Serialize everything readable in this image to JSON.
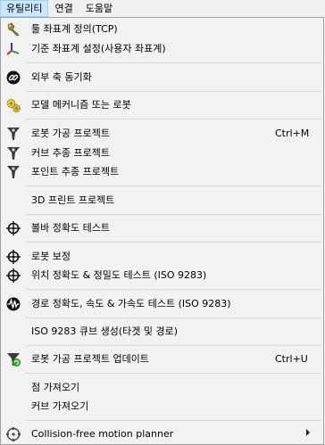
{
  "menubar": {
    "utility": "유틸리티",
    "connect": "연결",
    "help": "도움말"
  },
  "menu": {
    "tool_frame": "툴 좌표계 정의(TCP)",
    "reference_frame": "기준 좌표계 설정(사용자 좌표계)",
    "sync_external_axes": "외부 축 동기화",
    "model_mechanism_robot": "모델 메커니즘 또는 로봇",
    "machining_project": "로봇 가공 프로젝트",
    "machining_shortcut": "Ctrl+M",
    "curve_follow_project": "커브 추종 프로젝트",
    "point_follow_project": "포인트 추종 프로젝트",
    "print3d_project": "3D 프린트 프로젝트",
    "ballbar_test": "볼바 정확도 테스트",
    "robot_calibration": "로봇 보정",
    "position_accuracy_test": "위치 정확도 & 정밀도 테스트 (ISO 9283)",
    "path_accuracy_test": "경로 정확도, 속도 & 가속도 테스트 (ISO 9283)",
    "iso_cube": "ISO 9283 큐브 생성(타겟 및 경로)",
    "update_machining": "로봇 가공 프로젝트 업데이트",
    "update_shortcut": "Ctrl+U",
    "import_points": "점 가져오기",
    "import_curve": "커브 가져오기",
    "collision_free_planner": "Collision-free motion planner"
  },
  "icons": {
    "tool": "tool-icon",
    "frame": "reference-frame-icon",
    "sync": "sync-axes-icon",
    "mechanism": "mechanism-gears-icon",
    "machining": "machining-funnel-icon",
    "ballbar": "crosshair-icon",
    "waveform": "waveform-icon",
    "update": "update-machining-icon",
    "planner": "motion-planner-icon"
  },
  "colors": {
    "menubar_bg": "#f0f0f0",
    "menu_bg": "#f2f2f2",
    "active_bg": "#cce8ff",
    "active_border": "#99d1ff",
    "separator": "#d7d7d7"
  }
}
